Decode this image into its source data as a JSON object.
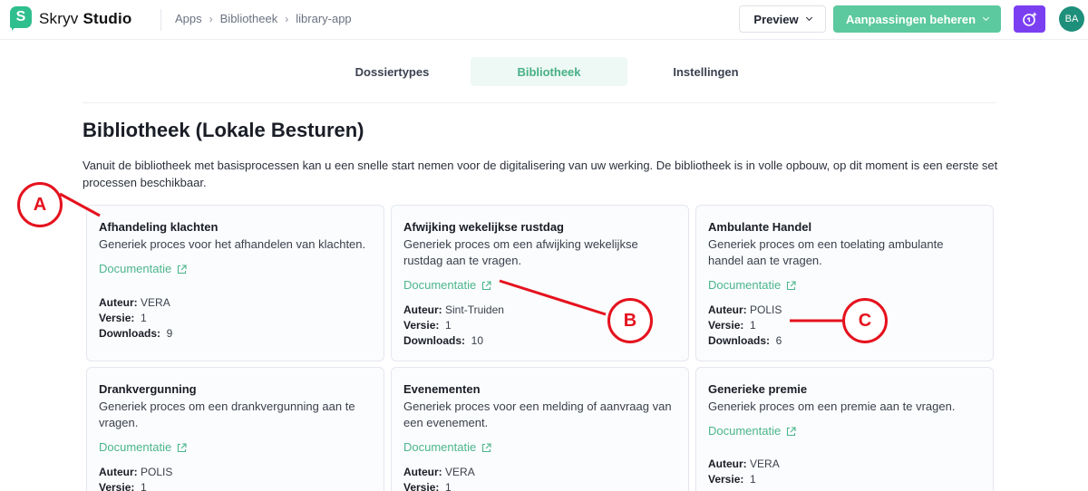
{
  "app": {
    "logo_letter": "S",
    "name_part1": "Skryv",
    "name_part2": "Studio"
  },
  "breadcrumb": [
    "Apps",
    "Bibliotheek",
    "library-app"
  ],
  "header": {
    "preview_label": "Preview",
    "manage_label": "Aanpassingen beheren",
    "avatar_initials": "BA"
  },
  "tabs": [
    {
      "label": "Dossiertypes",
      "active": false
    },
    {
      "label": "Bibliotheek",
      "active": true
    },
    {
      "label": "Instellingen",
      "active": false
    }
  ],
  "page": {
    "title": "Bibliotheek (Lokale Besturen)",
    "intro": "Vanuit de bibliotheek met basisprocessen kan u een snelle start nemen voor de digitalisering van uw werking. De bibliotheek is in volle opbouw, op dit moment is een eerste set processen beschikbaar."
  },
  "labels": {
    "auteur": "Auteur:",
    "versie": "Versie:",
    "downloads": "Downloads:",
    "doc": "Documentatie"
  },
  "cards": [
    {
      "title": "Afhandeling klachten",
      "desc": "Generiek proces voor het afhandelen van klachten.",
      "auteur": "VERA",
      "versie": "1",
      "downloads": "9"
    },
    {
      "title": "Afwijking wekelijkse rustdag",
      "desc": "Generiek proces om een afwijking wekelijkse rustdag aan te vragen.",
      "auteur": "Sint-Truiden",
      "versie": "1",
      "downloads": "10"
    },
    {
      "title": "Ambulante Handel",
      "desc": "Generiek proces om een toelating ambulante handel aan te vragen.",
      "auteur": "POLIS",
      "versie": "1",
      "downloads": "6"
    },
    {
      "title": "Drankvergunning",
      "desc": "Generiek proces om een drankvergunning aan te vragen.",
      "auteur": "POLIS",
      "versie": "1"
    },
    {
      "title": "Evenementen",
      "desc": "Generiek proces voor een melding of aanvraag van een evenement.",
      "auteur": "VERA",
      "versie": "1"
    },
    {
      "title": "Generieke premie",
      "desc": "Generiek proces om een premie aan te vragen.",
      "auteur": "VERA",
      "versie": "1"
    }
  ],
  "annotations": [
    "A",
    "B",
    "C"
  ],
  "colors": {
    "accent": "#5cc99f",
    "link": "#4bb58c",
    "magic": "#7b3ff2",
    "annotation": "#e5121e"
  }
}
